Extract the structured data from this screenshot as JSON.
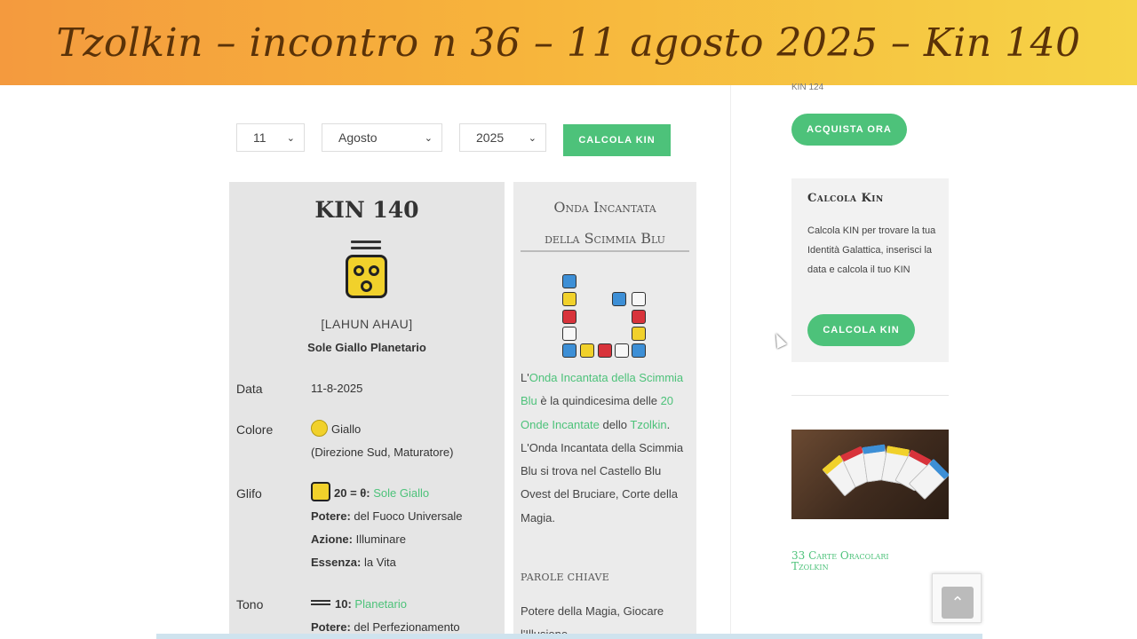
{
  "banner": {
    "title": "Tzolkin – incontro n 36 – 11 agosto 2025 – Kin 140"
  },
  "form": {
    "day": "11",
    "month": "Agosto",
    "year": "2025",
    "submit_label": "CALCOLA KIN"
  },
  "kin": {
    "title": "KIN 140",
    "name": "[LAHUN AHAU]",
    "subtitle": "Sole Giallo Planetario",
    "rows": {
      "data": {
        "label": "Data",
        "value": "11-8-2025"
      },
      "colore": {
        "label": "Colore",
        "value": "Giallo",
        "detail": "(Direzione Sud, Maturatore)"
      },
      "glifo": {
        "label": "Glifo",
        "code": "20 = θ:",
        "link": "Sole Giallo",
        "potere_label": "Potere:",
        "potere": "del Fuoco Universale",
        "azione_label": "Azione:",
        "azione": "Illuminare",
        "essenza_label": "Essenza:",
        "essenza": "la Vita"
      },
      "tono": {
        "label": "Tono",
        "code": "10:",
        "link": "Planetario",
        "potere_label": "Potere:",
        "potere": "del Perfezionamento"
      }
    }
  },
  "onda": {
    "title_line1": "Onda Incantata",
    "title_line2": "della Scimmia Blu",
    "text_prefix": "L'",
    "link1": "Onda Incantata della Scimmia Blu",
    "text_mid1": "è la quindicesima delle",
    "link2": "20 Onde Incantate",
    "text_mid2": "dello",
    "link3": "Tzolkin",
    "text_end": "L'Onda Incantata della Scimmia Blu si trova nel Castello Blu Ovest del Bruciare, Corte della Magia.",
    "keywords_label": "PAROLE CHIAVE",
    "keywords": "Potere della Magia, Giocare l'Illusione"
  },
  "sidebar": {
    "kin_small": "KIN 124",
    "buy_label": "ACQUISTA ORA",
    "widget_title": "Calcola Kin",
    "widget_text": "Calcola KIN per trovare la tua Identità Galattica, inserisci la data e calcola il tuo KIN",
    "widget_button": "CALCOLA KIN",
    "product_title_line1": "33 Carte Oracolari",
    "product_title_line2": "Tzolkin"
  },
  "colors": {
    "accent": "#4dc27a",
    "yellow": "#f1d12b",
    "blue": "#3d8fd6",
    "red": "#d8333b"
  }
}
